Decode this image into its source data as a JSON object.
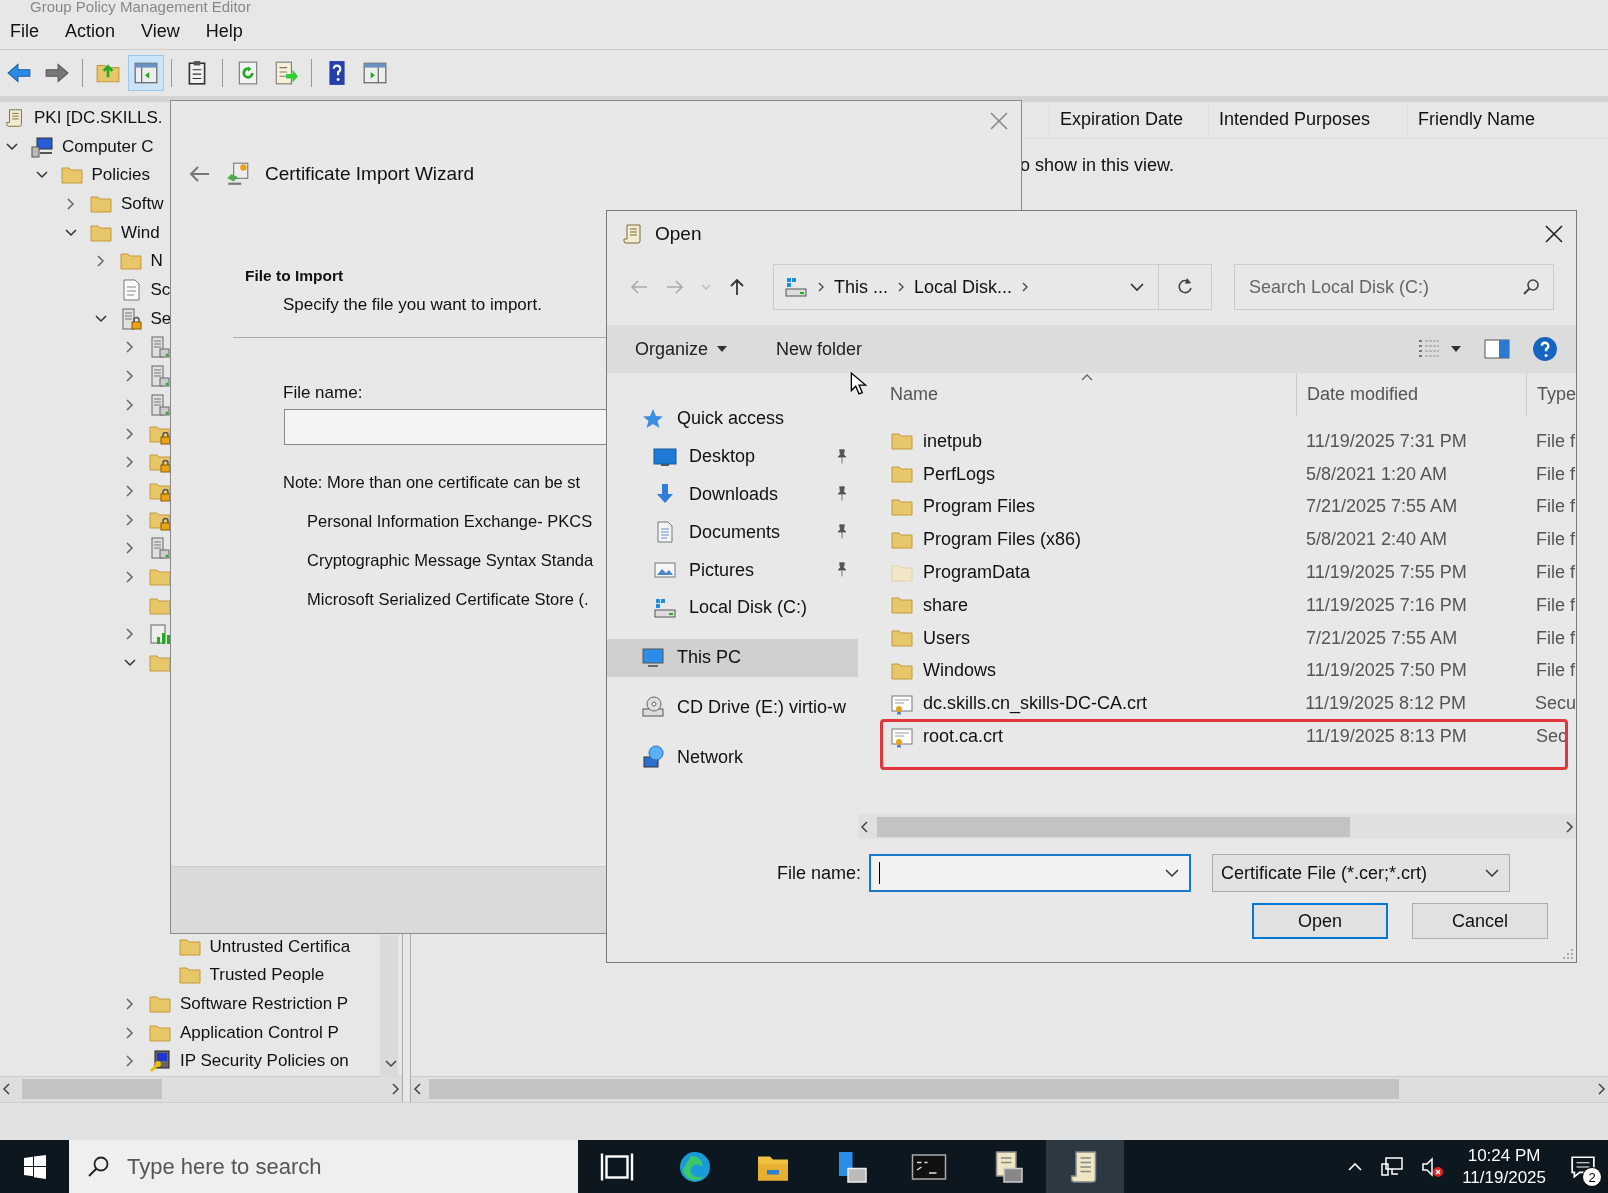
{
  "window": {
    "title": "Group Policy Management Editor"
  },
  "menu": [
    "File",
    "Action",
    "View",
    "Help"
  ],
  "toolbar": [
    {
      "kind": "back",
      "pressed": false
    },
    {
      "kind": "forward",
      "pressed": false
    },
    {
      "kind": "separator"
    },
    {
      "kind": "up",
      "pressed": false
    },
    {
      "kind": "console-tree",
      "pressed": true
    },
    {
      "kind": "separator"
    },
    {
      "kind": "properties",
      "pressed": false
    },
    {
      "kind": "separator"
    },
    {
      "kind": "refresh",
      "pressed": false
    },
    {
      "kind": "export",
      "pressed": false
    },
    {
      "kind": "separator"
    },
    {
      "kind": "help",
      "pressed": false
    },
    {
      "kind": "action-pane",
      "pressed": false
    }
  ],
  "tree": [
    {
      "label": "PKI [DC.SKILLS.",
      "kind": "scroll",
      "children": [
        {
          "label": "Computer C",
          "kind": "computer",
          "expanded": true,
          "children": [
            {
              "label": "Policies",
              "kind": "folder",
              "expanded": true,
              "children": [
                {
                  "label": "Softw",
                  "kind": "folder",
                  "expanded": false
                },
                {
                  "label": "Wind",
                  "kind": "folder",
                  "expanded": true,
                  "children": [
                    {
                      "label": "N",
                      "kind": "folder",
                      "expanded": false
                    },
                    {
                      "label": "Sc",
                      "kind": "script"
                    },
                    {
                      "label": "Se",
                      "kind": "lockserver",
                      "expanded": true,
                      "children": [
                        {
                          "kind": "server",
                          "expanded": false
                        },
                        {
                          "kind": "server",
                          "expanded": false
                        },
                        {
                          "kind": "server",
                          "expanded": false
                        },
                        {
                          "kind": "lockfolder",
                          "expanded": false
                        },
                        {
                          "kind": "lockfolder",
                          "expanded": false
                        },
                        {
                          "kind": "lockfolder",
                          "expanded": false
                        },
                        {
                          "kind": "lockfolder",
                          "expanded": false
                        },
                        {
                          "kind": "server",
                          "expanded": false
                        },
                        {
                          "kind": "folder",
                          "expanded": false
                        },
                        {
                          "kind": "folder"
                        },
                        {
                          "kind": "chart",
                          "expanded": false
                        },
                        {
                          "kind": "folder",
                          "expanded": true,
                          "children": [
                            {
                              "label": "Untrusted Certifica",
                              "kind": "folder"
                            },
                            {
                              "label": "Trusted People",
                              "kind": "folder"
                            }
                          ]
                        },
                        {
                          "label": "Software Restriction P",
                          "kind": "folder",
                          "expanded": false
                        },
                        {
                          "label": "Application Control P",
                          "kind": "folder",
                          "expanded": false
                        },
                        {
                          "label": "IP Security Policies on",
                          "kind": "ipsec",
                          "expanded": false
                        }
                      ]
                    }
                  ]
                }
              ]
            }
          ]
        }
      ]
    }
  ],
  "list_pane": {
    "columns": [
      "Expiration Date",
      "Intended Purposes",
      "Friendly Name"
    ],
    "message": "o show in this view."
  },
  "wizard": {
    "title": "Certificate Import Wizard",
    "heading": "File to Import",
    "subheading": "Specify the file you want to import.",
    "file_label": "File name:",
    "note": "Note:  More than one certificate can be st",
    "formats": [
      "Personal Information Exchange- PKCS",
      "Cryptographic Message Syntax Standa",
      "Microsoft Serialized Certificate Store (."
    ]
  },
  "open_dialog": {
    "title": "Open",
    "address": [
      "This ...",
      "Local Disk..."
    ],
    "search_placeholder": "Search Local Disk (C:)",
    "organize": "Organize",
    "new_folder": "New folder",
    "nav": [
      {
        "label": "Quick access",
        "kind": "star",
        "selected": false,
        "children": [
          {
            "label": "Desktop",
            "kind": "desktop",
            "pinned": true,
            "selected": false
          },
          {
            "label": "Downloads",
            "kind": "download",
            "pinned": true,
            "selected": false
          },
          {
            "label": "Documents",
            "kind": "documents",
            "pinned": true,
            "selected": false
          },
          {
            "label": "Pictures",
            "kind": "pictures",
            "pinned": true,
            "selected": false
          },
          {
            "label": "Local Disk (C:)",
            "kind": "drive",
            "pinned": false,
            "selected": false
          }
        ]
      },
      {
        "label": "This PC",
        "kind": "pc",
        "selected": true
      },
      {
        "label": "CD Drive (E:) virtio-w",
        "kind": "cd",
        "selected": false
      },
      {
        "label": "Network",
        "kind": "network",
        "selected": false
      }
    ],
    "columns": [
      "Name",
      "Date modified",
      "Type"
    ],
    "files": [
      {
        "name": "inetpub",
        "date": "11/19/2025 7:31 PM",
        "type": "File f",
        "kind": "folder",
        "annotated": false
      },
      {
        "name": "PerfLogs",
        "date": "5/8/2021 1:20 AM",
        "type": "File f",
        "kind": "folder",
        "annotated": false
      },
      {
        "name": "Program Files",
        "date": "7/21/2025 7:55 AM",
        "type": "File f",
        "kind": "folder",
        "annotated": false
      },
      {
        "name": "Program Files (x86)",
        "date": "5/8/2021 2:40 AM",
        "type": "File f",
        "kind": "folder",
        "annotated": false
      },
      {
        "name": "ProgramData",
        "date": "11/19/2025 7:55 PM",
        "type": "File f",
        "kind": "folder-faded",
        "annotated": false
      },
      {
        "name": "share",
        "date": "11/19/2025 7:16 PM",
        "type": "File f",
        "kind": "folder",
        "annotated": false
      },
      {
        "name": "Users",
        "date": "7/21/2025 7:55 AM",
        "type": "File f",
        "kind": "folder",
        "annotated": false
      },
      {
        "name": "Windows",
        "date": "11/19/2025 7:50 PM",
        "type": "File f",
        "kind": "folder",
        "annotated": false
      },
      {
        "name": "dc.skills.cn_skills-DC-CA.crt",
        "date": "11/19/2025 8:12 PM",
        "type": "Secu",
        "kind": "cert",
        "annotated": false
      },
      {
        "name": "root.ca.crt",
        "date": "11/19/2025 8:13 PM",
        "type": "Sec",
        "kind": "cert",
        "annotated": true
      }
    ],
    "filename_label": "File name:",
    "filter": "Certificate File (*.cer;*.crt)",
    "buttons": [
      {
        "label": "Open",
        "default": true
      },
      {
        "label": "Cancel",
        "default": false
      }
    ]
  },
  "taskbar": {
    "search_placeholder": "Type here to search",
    "apps": [
      {
        "kind": "taskview",
        "active": false
      },
      {
        "kind": "browser",
        "active": false
      },
      {
        "kind": "explorer",
        "active": false
      },
      {
        "kind": "server",
        "active": false
      },
      {
        "kind": "terminal",
        "active": false
      },
      {
        "kind": "certmgr",
        "active": false
      },
      {
        "kind": "scroll",
        "active": true
      }
    ],
    "time": "10:24 PM",
    "date": "11/19/2025",
    "notifications": "2"
  }
}
